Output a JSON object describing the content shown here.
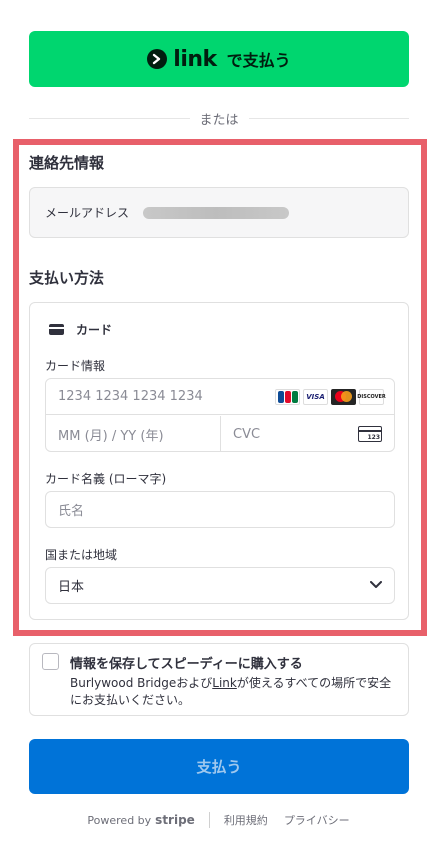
{
  "link_button": {
    "logo_word": "link",
    "label": "で支払う",
    "color": "#00d66f"
  },
  "divider": {
    "label": "または"
  },
  "contact": {
    "title": "連絡先情報",
    "email_label": "メールアドレス"
  },
  "payment": {
    "title": "支払い方法",
    "tab_label": "カード",
    "card_info_label": "カード情報",
    "card_number_placeholder": "1234 1234 1234 1234",
    "expiry_placeholder": "MM (月) / YY (年)",
    "cvc_placeholder": "CVC",
    "cvc_icon_text": "123",
    "brands": [
      "JCB",
      "VISA",
      "Mastercard",
      "DISCOVER"
    ],
    "name_label": "カード名義 (ローマ字)",
    "name_placeholder": "氏名",
    "country_label": "国または地域",
    "country_value": "日本"
  },
  "save": {
    "title": "情報を保存してスピーディーに購入する",
    "desc_before": "Burlywood Bridgeおよび",
    "desc_link": "Link",
    "desc_after": "が使えるすべての場所で安全にお支払いください。"
  },
  "pay_button": {
    "label": "支払う",
    "color": "#0073d8"
  },
  "footer": {
    "powered": "Powered by",
    "brand": "stripe",
    "terms": "利用規約",
    "privacy": "プライバシー"
  },
  "colors": {
    "highlight": "#e8606a",
    "text": "#30313d"
  }
}
